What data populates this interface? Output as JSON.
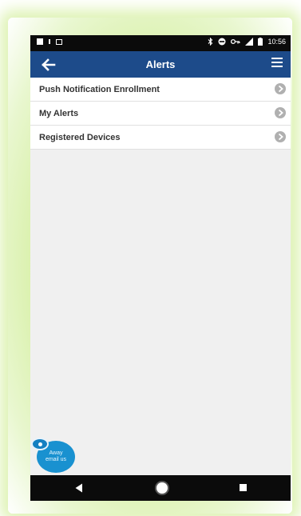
{
  "status_bar": {
    "time": "10:56",
    "icons": [
      "image-icon",
      "dot-icon",
      "calendar-icon",
      "bluetooth-icon",
      "do-not-disturb-icon",
      "key-icon",
      "signal-icon",
      "battery-icon"
    ]
  },
  "app_bar": {
    "title": "Alerts",
    "back_icon": "arrow-left-icon",
    "menu_icon": "hamburger-menu-icon",
    "color": "#1d4b8a"
  },
  "menu": {
    "items": [
      {
        "label": "Push Notification Enrollment"
      },
      {
        "label": "My Alerts"
      },
      {
        "label": "Registered Devices"
      }
    ],
    "chevron_icon": "chevron-right-circle-icon"
  },
  "email_widget": {
    "line1": "Away",
    "line2": "email us",
    "color": "#1991d0"
  },
  "nav_bar": {
    "back_icon": "triangle-back-icon",
    "home_icon": "circle-home-icon",
    "recents_icon": "square-recents-icon"
  }
}
